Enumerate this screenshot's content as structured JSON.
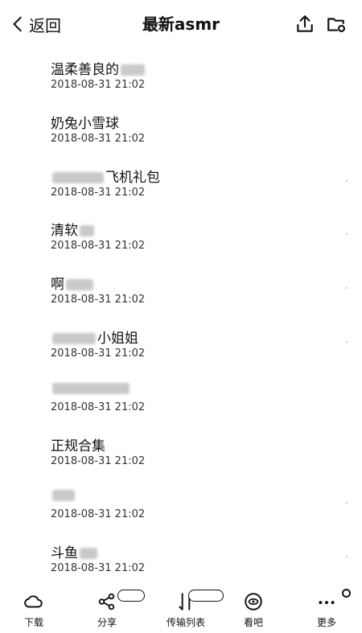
{
  "header": {
    "back_label": "返回",
    "title": "最新asmr",
    "back_icon": "chevron-left-icon",
    "upload_icon": "upload-icon",
    "folder_icon": "folder-settings-icon"
  },
  "files": [
    {
      "name": "温柔善良的",
      "date": "2018-08-31 21:02"
    },
    {
      "name": "奶兔小雪球",
      "date": "2018-08-31 21:02"
    },
    {
      "name": "飞机礼包",
      "date": "2018-08-31 21:02"
    },
    {
      "name": "清软",
      "date": "2018-08-31 21:02"
    },
    {
      "name": "啊",
      "date": "2018-08-31 21:02"
    },
    {
      "name": "小姐姐",
      "date": "2018-08-31 21:02"
    },
    {
      "name": "",
      "date": "2018-08-31 21:02"
    },
    {
      "name": "正规合集",
      "date": "2018-08-31 21:02"
    },
    {
      "name": "",
      "date": "2018-08-31 21:02"
    },
    {
      "name": "斗鱼",
      "date": "2018-08-31 21:02"
    }
  ],
  "tabbar": {
    "tabs": [
      {
        "label": "下载",
        "icon": "cloud-download-icon"
      },
      {
        "label": "分享",
        "icon": "share-icon"
      },
      {
        "label": "传输列表",
        "icon": "transfer-icon"
      },
      {
        "label": "看吧",
        "icon": "eye-icon"
      },
      {
        "label": "更多",
        "icon": "more-icon"
      }
    ]
  },
  "colors": {
    "text": "#111111",
    "background": "#ffffff",
    "secondary": "#333333"
  }
}
